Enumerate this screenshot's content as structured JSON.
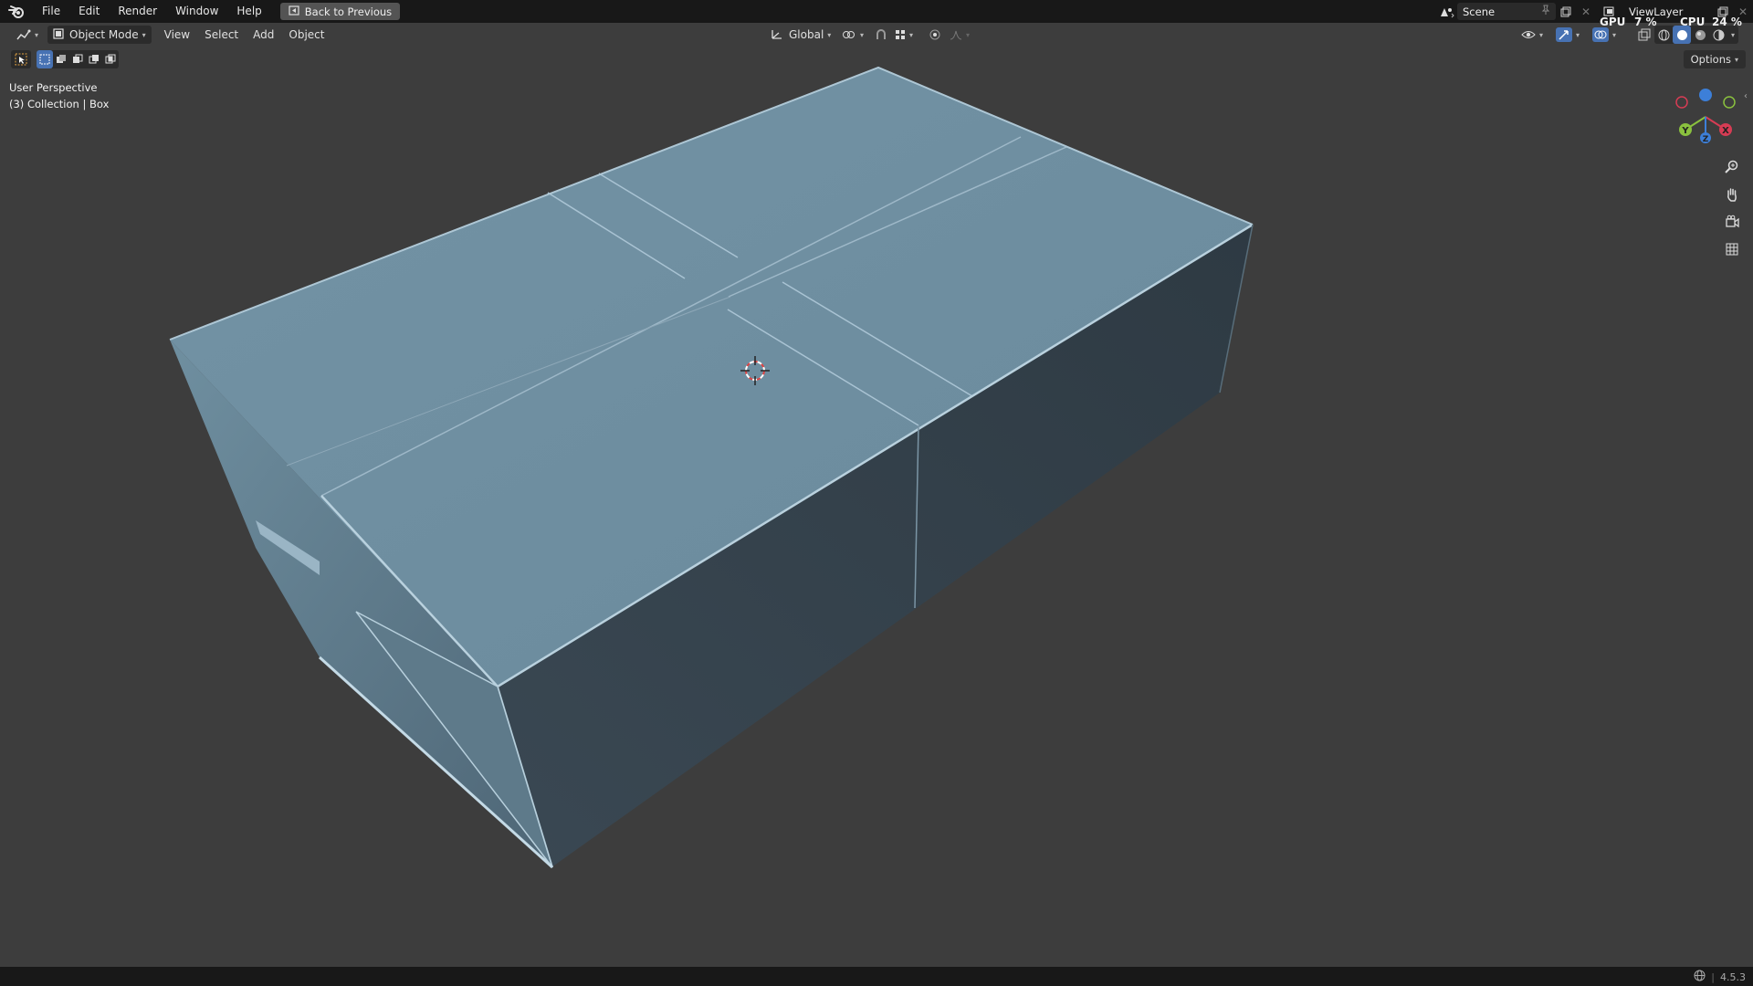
{
  "topbar": {
    "menus": [
      "File",
      "Edit",
      "Render",
      "Window",
      "Help"
    ],
    "back_button": "Back to Previous",
    "scene": "Scene",
    "view_layer": "ViewLayer",
    "gpu_label": "GPU",
    "gpu_value": "7 %",
    "cpu_label": "CPU",
    "cpu_value": "24 %"
  },
  "viewport_header": {
    "mode": "Object Mode",
    "menus": [
      "View",
      "Select",
      "Add",
      "Object"
    ],
    "orientation": "Global"
  },
  "viewport": {
    "perspective": "User Perspective",
    "collection": "(3) Collection | Box",
    "options": "Options"
  },
  "gizmo": {
    "x": "X",
    "y": "Y",
    "z": "Z"
  },
  "statusbar": {
    "version": "4.5.3"
  },
  "colors": {
    "accent": "#4772b3",
    "mesh_top": "#6f8fa1",
    "mesh_side": "#3c4b57",
    "axis_x": "#d63c54",
    "axis_y": "#8ac13e",
    "axis_z": "#3d7fd8"
  },
  "icons": [
    "blender-logo-icon",
    "back-icon",
    "scene-icon",
    "pin-icon",
    "copy-icon",
    "view-layer-icon",
    "editor-type-icon",
    "object-mode-icon",
    "transform-orientation-icon",
    "pivot-icon",
    "snap-icon",
    "proportional-edit-icon",
    "select-box-icon",
    "visibility-icon",
    "gizmo-icon",
    "overlay-icon",
    "xray-icon",
    "wireframe-shading-icon",
    "solid-shading-icon",
    "material-shading-icon",
    "rendered-shading-icon",
    "zoom-icon",
    "pan-hand-icon",
    "camera-icon",
    "grid-icon",
    "language-icon",
    "3d-cursor-icon"
  ]
}
